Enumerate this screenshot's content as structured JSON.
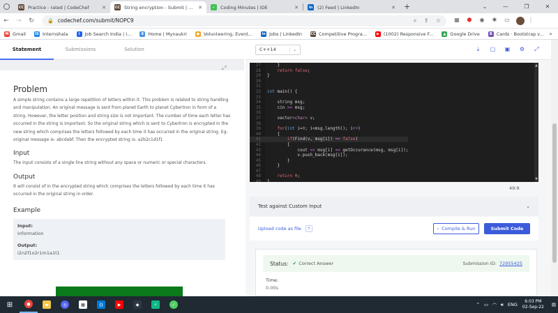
{
  "browser": {
    "tabs": [
      {
        "label": "Practice - rated | CodeChef",
        "icon": "codechef-icon",
        "color": "#5b4638",
        "glyph": "CC",
        "active": false
      },
      {
        "label": "String encryption - Submit | Code",
        "icon": "codechef-icon",
        "color": "#5b4638",
        "glyph": "CC",
        "active": true
      },
      {
        "label": "Coding Minutes | IDE",
        "icon": "coding-minutes-icon",
        "color": "#40c057",
        "glyph": "✓",
        "active": false
      },
      {
        "label": "(2) Feed | LinkedIn",
        "icon": "linkedin-icon",
        "color": "#0a66c2",
        "glyph": "in",
        "active": false
      }
    ],
    "url": "codechef.com/submit/NOPC9",
    "bookmarks": [
      {
        "label": "Gmail",
        "color": "#ea4335",
        "glyph": "M"
      },
      {
        "label": "Internshala",
        "color": "#1e88e5",
        "glyph": "IS"
      },
      {
        "label": "Job Search India | I...",
        "color": "#2164f3",
        "glyph": "i"
      },
      {
        "label": "Home | Mynaukri",
        "color": "#4a90e2",
        "glyph": "K"
      },
      {
        "label": "Volunteering, Event...",
        "color": "#f5a623",
        "glyph": "●"
      },
      {
        "label": "Jobs | LinkedIn",
        "color": "#0a66c2",
        "glyph": "in"
      },
      {
        "label": "Competitive Progra...",
        "color": "#5b4638",
        "glyph": "CC"
      },
      {
        "label": "(1002) Responsive F...",
        "color": "#ff0000",
        "glyph": "▶"
      },
      {
        "label": "Google Drive",
        "color": "#34a853",
        "glyph": "▲"
      },
      {
        "label": "Cards · Bootstrap v...",
        "color": "#7952b3",
        "glyph": "B"
      }
    ]
  },
  "left": {
    "tabs": [
      "Statement",
      "Submissions",
      "Solution"
    ],
    "problem_title": "Problem",
    "problem_text": "A simple string contains a large repetition of letters within it. This problem is related to string handling and manipulation. An original message is sent from planet Earth to planet Cybertron in form of a string. However, the letter position and string size is not important. The number of time each letter has occurred in the string is important. So the original string which is sent to Cybertron is encrypted in the new string which comprises the letters followed by each time it has occurred in the original string. Eg- original message is- abcdabf. Then the encrypted string is- a2b2c1d1f1",
    "input_title": "Input",
    "input_text": "The input consists of a single line string without any space or numeric or special characters.",
    "output_title": "Output",
    "output_text": "It will consist of in the encrypted string which comprises the letters followed by each time it has occurred in the original string in order.",
    "example_title": "Example",
    "example": {
      "input_label": "Input:",
      "input_value": "information",
      "output_label": "Output:",
      "output_value": "i2n2f1o2r1m1a1t1"
    }
  },
  "editor": {
    "language": "C++14",
    "cursor_pos": "49:9",
    "lines": [
      {
        "n": "27",
        "html": "    <span class='ct'>}</span>"
      },
      {
        "n": "28",
        "html": "    <span class='kr'>return false</span><span class='ct'>;</span>"
      },
      {
        "n": "29",
        "html": "<span class='ct'>}</span>"
      },
      {
        "n": "30",
        "html": ""
      },
      {
        "n": "31",
        "html": ""
      },
      {
        "n": "32",
        "html": "<span class='kw'>int</span> <span class='ct'>main() {</span>"
      },
      {
        "n": "33",
        "html": ""
      },
      {
        "n": "34",
        "html": "    <span class='ct'>string msg;</span>"
      },
      {
        "n": "35",
        "html": "    <span class='ct'>cin </span><span class='op'>&gt;&gt;</span><span class='ct'> msg;</span>"
      },
      {
        "n": "36",
        "html": ""
      },
      {
        "n": "37",
        "html": "    <span class='ct'>vector</span><span class='ty'>&lt;char&gt;</span><span class='ct'> v;</span>"
      },
      {
        "n": "38",
        "html": ""
      },
      {
        "n": "39",
        "html": "    <span class='kr'>for</span><span class='ct'>(</span><span class='kw'>int</span><span class='ct'> i=</span><span class='nm'>0</span><span class='ct'>; i&lt;msg.length(); i</span><span class='op'>++</span><span class='ct'>)</span>"
      },
      {
        "n": "40",
        "html": "    <span class='ct'>{</span>"
      },
      {
        "n": "41",
        "html": "        <span class='kr'>if</span><span class='ct'>(Find(v, msg[i]) </span><span class='op'>==</span><span class='kr'> false</span><span class='ct'>)</span>"
      },
      {
        "n": "42",
        "html": "        <span class='ct'>{</span>"
      },
      {
        "n": "43",
        "html": "            <span class='ct'>cout </span><span class='op'>&lt;&lt;</span><span class='ct'> msg[i] </span><span class='op'>&lt;&lt;</span><span class='ct'> getOccurance(msg, msg[i]);</span>"
      },
      {
        "n": "44",
        "html": "            <span class='ct'>v.push_back(msg[i]);</span>"
      },
      {
        "n": "45",
        "html": "        <span class='ct'>}</span>"
      },
      {
        "n": "46",
        "html": "    <span class='ct'>}</span>"
      },
      {
        "n": "47",
        "html": ""
      },
      {
        "n": "48",
        "html": "    <span class='kr'>return</span> <span class='nm'>0</span><span class='ct'>;</span>"
      },
      {
        "n": "49",
        "html": "<span class='ct'>}</span>"
      }
    ]
  },
  "actions": {
    "custom_input": "Test against Custom Input",
    "upload": "Upload code as file",
    "compile_run": "Compile & Run",
    "submit": "Submit Code"
  },
  "result": {
    "status_label": "Status:",
    "status_value": "Correct Answer",
    "submission_label": "Submission ID:",
    "submission_id": "72955425",
    "time_label": "Time:",
    "time_value": "0.00s"
  },
  "taskbar": {
    "lang": "ENG",
    "time": "6:03 PM",
    "date": "02-Sep-22"
  }
}
